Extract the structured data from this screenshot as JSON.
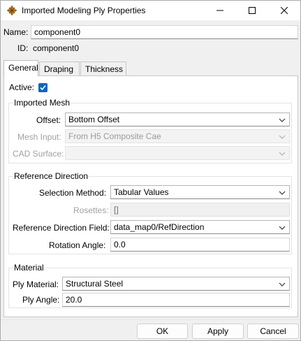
{
  "window": {
    "title": "Imported Modeling Ply Properties",
    "controls": [
      "minimize-icon",
      "maximize-icon",
      "close-icon"
    ]
  },
  "header": {
    "name_label": "Name:",
    "name_value": "component0",
    "id_label": "ID:",
    "id_value": "component0"
  },
  "tabs": [
    {
      "label": "General",
      "active": true
    },
    {
      "label": "Draping",
      "active": false
    },
    {
      "label": "Thickness",
      "active": false
    }
  ],
  "general": {
    "active_label": "Active:",
    "active_checked": true
  },
  "imported_mesh": {
    "title": "Imported Mesh",
    "offset_label": "Offset:",
    "offset_value": "Bottom Offset",
    "mesh_input_label": "Mesh Input:",
    "mesh_input_value": "From H5 Composite Cae",
    "cad_surface_label": "CAD Surface:",
    "cad_surface_value": ""
  },
  "reference_direction": {
    "title": "Reference Direction",
    "selection_method_label": "Selection Method:",
    "selection_method_value": "Tabular Values",
    "rosettes_label": "Rosettes:",
    "rosettes_value": "[]",
    "ref_dir_field_label": "Reference Direction Field:",
    "ref_dir_field_value": "data_map0/RefDirection",
    "rotation_angle_label": "Rotation Angle:",
    "rotation_angle_value": "0.0"
  },
  "material": {
    "title": "Material",
    "ply_material_label": "Ply Material:",
    "ply_material_value": "Structural Steel",
    "ply_angle_label": "Ply Angle:",
    "ply_angle_value": "20.0"
  },
  "footer": {
    "ok_label": "OK",
    "apply_label": "Apply",
    "cancel_label": "Cancel"
  },
  "colors": {
    "accent": "#0067c0",
    "disabled_text": "#a0a0a0"
  }
}
